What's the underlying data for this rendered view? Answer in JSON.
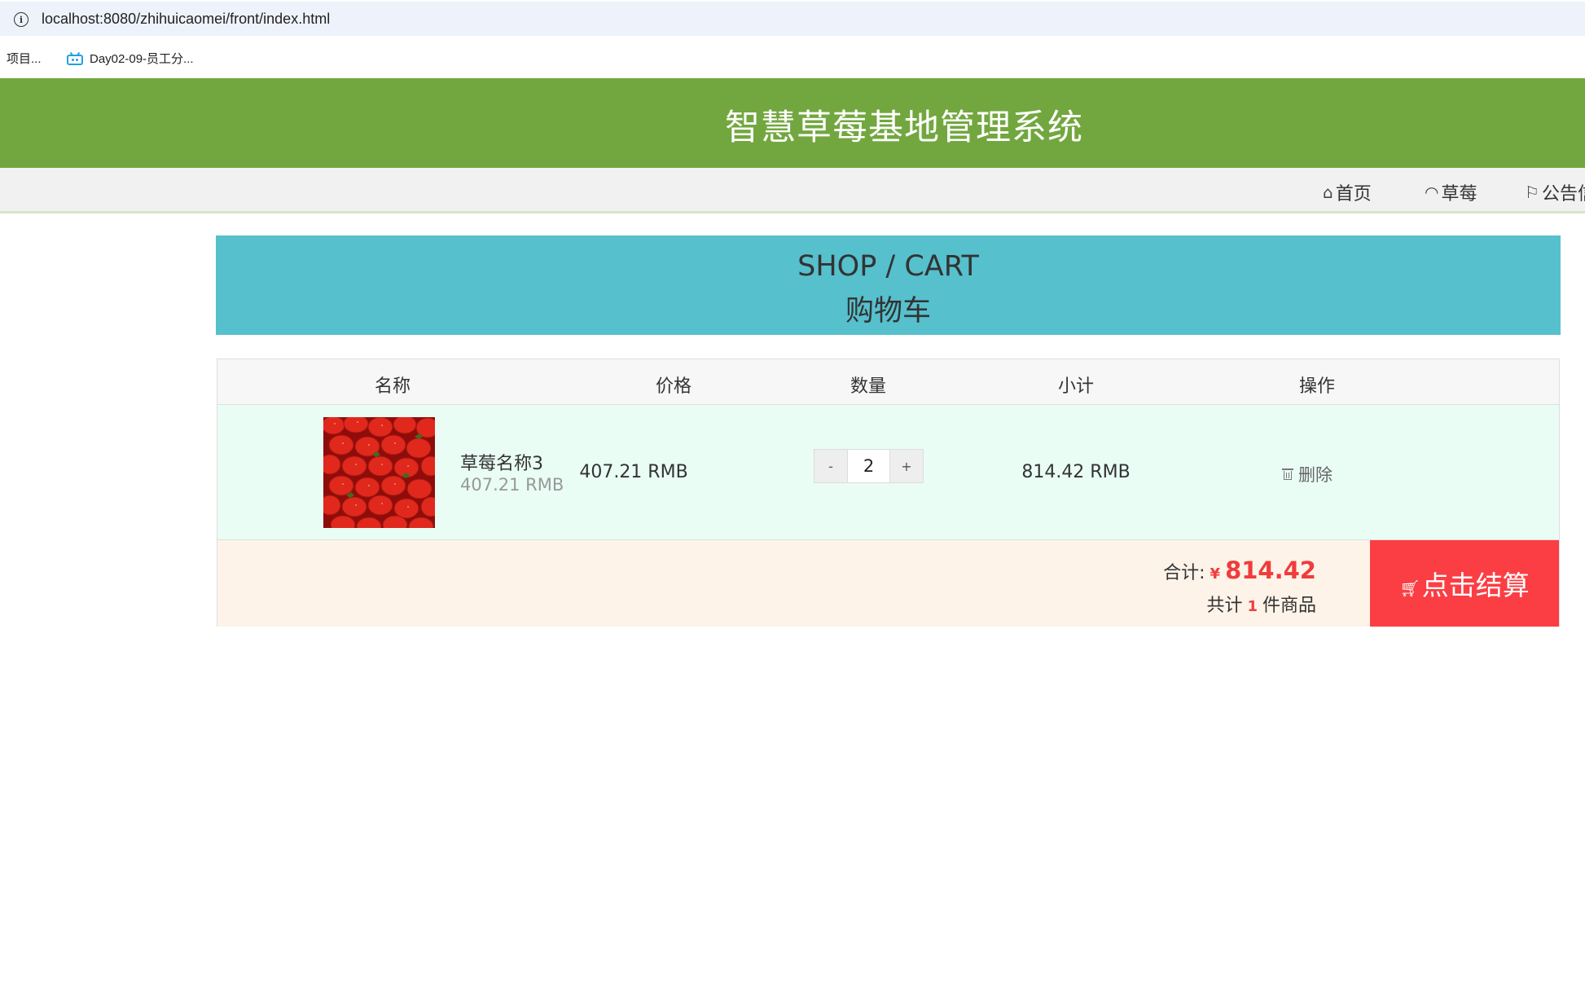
{
  "browser": {
    "url": "localhost:8080/zhihuicaomei/front/index.html",
    "bookmarks": [
      {
        "label": "项目..."
      },
      {
        "label": "Day02-09-员工分..."
      }
    ]
  },
  "header": {
    "title": "智慧草莓基地管理系统"
  },
  "nav": {
    "items": [
      {
        "label": "首页",
        "icon": "home-icon"
      },
      {
        "label": "草莓",
        "icon": "gauge-icon"
      },
      {
        "label": "公告信",
        "icon": "flag-icon"
      }
    ]
  },
  "banner": {
    "en": "SHOP / CART",
    "cn": "购物车"
  },
  "table": {
    "columns": [
      "名称",
      "价格",
      "数量",
      "小计",
      "操作"
    ],
    "rows": [
      {
        "name": "草莓名称3",
        "sub_price": "407.21 RMB",
        "price": "407.21 RMB",
        "qty_minus": "-",
        "quantity": "2",
        "qty_plus": "+",
        "subtotal": "814.42 RMB",
        "action": "删除"
      }
    ]
  },
  "summary": {
    "total_label": "合计:",
    "currency": "¥",
    "total": "814.42",
    "count_prefix": "共计",
    "count": "1",
    "count_suffix": "件商品",
    "checkout": "点击结算"
  },
  "colors": {
    "header_bg": "#72a73f",
    "banner_bg": "#56c0cd",
    "row_bg": "#e9fdf5",
    "footer_bg": "#fdf3e9",
    "checkout_bg": "#fb3e44",
    "accent_red": "#f03c3c"
  }
}
